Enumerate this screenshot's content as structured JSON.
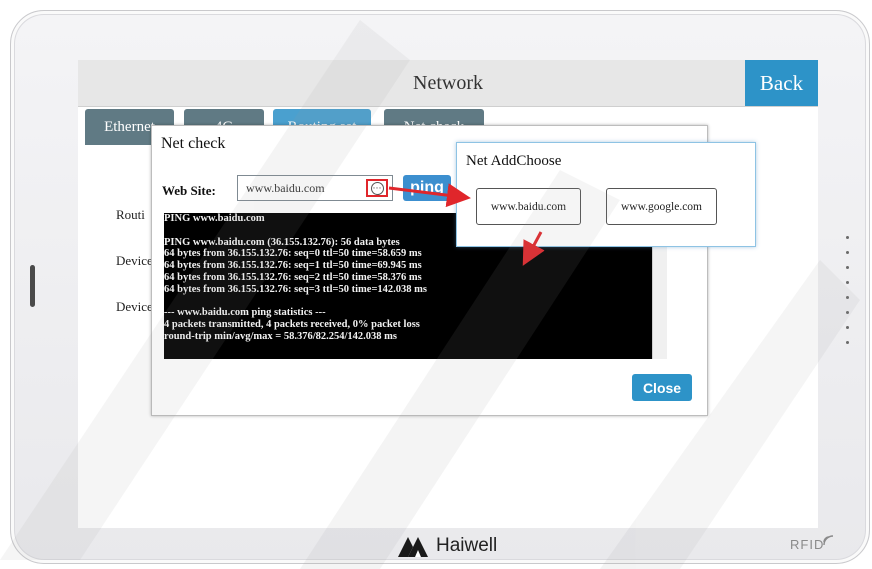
{
  "screen": {
    "title": "Network",
    "back_label": "Back",
    "tabs": [
      {
        "label": "Ethernet"
      },
      {
        "label": "4G"
      },
      {
        "label": "Routing set"
      },
      {
        "label": "Net check"
      }
    ],
    "side_labels": [
      "Routi",
      "Device",
      "Device"
    ]
  },
  "net_check_dialog": {
    "title": "Net check",
    "web_site_label": "Web Site:",
    "web_site_value": "www.baidu.com",
    "more_icon": "ellipsis-circle-icon",
    "ping_label": "ping",
    "console_lines": [
      "PING www.baidu.com",
      "",
      "PING www.baidu.com (36.155.132.76): 56 data bytes",
      "64 bytes from 36.155.132.76: seq=0 ttl=50 time=58.659 ms",
      "64 bytes from 36.155.132.76: seq=1 ttl=50 time=69.945 ms",
      "64 bytes from 36.155.132.76: seq=2 ttl=50 time=58.376 ms",
      "64 bytes from 36.155.132.76: seq=3 ttl=50 time=142.038 ms",
      "",
      "--- www.baidu.com ping statistics ---",
      "4 packets transmitted, 4 packets received, 0% packet loss",
      "round-trip min/avg/max = 58.376/82.254/142.038 ms"
    ],
    "close_label": "Close"
  },
  "add_choose_popup": {
    "title": "Net AddChoose",
    "options": [
      "www.baidu.com",
      "www.google.com"
    ]
  },
  "device": {
    "brand_name": "Haiwell",
    "rfid_label": "RFID"
  },
  "colors": {
    "accent_blue": "#2d93c8",
    "tab_dark": "#607a84",
    "annotation_red": "#e0262b"
  }
}
